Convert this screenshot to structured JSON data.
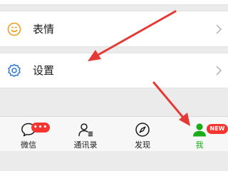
{
  "menu": {
    "emoji_label": "表情",
    "settings_label": "设置"
  },
  "tabbar": {
    "tabs": [
      {
        "label": "微信",
        "badge": "•••"
      },
      {
        "label": "通讯录"
      },
      {
        "label": "发现"
      },
      {
        "label": "我",
        "badge": "NEW"
      }
    ]
  },
  "colors": {
    "active_tab": "#1aad19",
    "badge": "#f43530",
    "arrow": "#e53935",
    "emoji_icon": "#f0a020",
    "settings_icon": "#3b7fd9"
  }
}
